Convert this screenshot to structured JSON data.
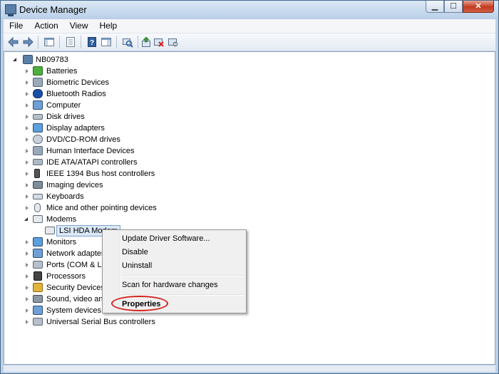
{
  "window": {
    "title": "Device Manager"
  },
  "window_controls": {
    "minimize_glyph": "▁",
    "maximize_glyph": "☐",
    "close_glyph": "✕"
  },
  "menu": [
    "File",
    "Action",
    "View",
    "Help"
  ],
  "toolbar": {
    "buttons": [
      "back-icon",
      "forward-icon",
      "show-hide-tree-icon",
      "properties-icon",
      "help-icon",
      "action-pane-icon",
      "scan-hardware-icon",
      "update-driver-icon",
      "uninstall-icon",
      "disable-icon"
    ]
  },
  "tree": {
    "root": "NB09783",
    "categories": [
      "Batteries",
      "Biometric Devices",
      "Bluetooth Radios",
      "Computer",
      "Disk drives",
      "Display adapters",
      "DVD/CD-ROM drives",
      "Human Interface Devices",
      "IDE ATA/ATAPI controllers",
      "IEEE 1394 Bus host controllers",
      "Imaging devices",
      "Keyboards",
      "Mice and other pointing devices",
      "Modems",
      "Monitors",
      "Network adapter",
      "Ports (COM & LP",
      "Processors",
      "Security Devices",
      "Sound, video and",
      "System devices",
      "Universal Serial Bus controllers"
    ],
    "expanded_category": "Modems",
    "selected_device": "LSI HDA Modem"
  },
  "context_menu": {
    "items": [
      "Update Driver Software...",
      "Disable",
      "Uninstall",
      "Scan for hardware changes",
      "Properties"
    ],
    "highlighted": "Properties",
    "highlight_color": "#d3211a"
  }
}
